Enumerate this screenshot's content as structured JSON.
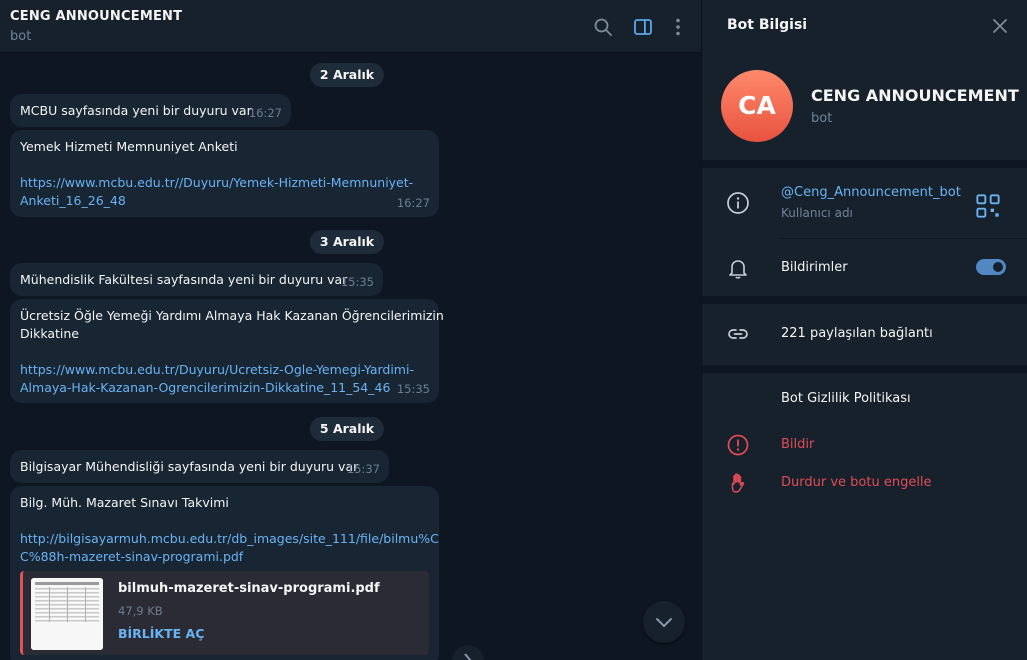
{
  "colors": {
    "accent": "#6ab3f3",
    "danger": "#e04b55",
    "bubble": "#182533",
    "panel": "#17212b",
    "background": "#0e1621",
    "avatar": "#ef6b50"
  },
  "header": {
    "title": "CENG ANNOUNCEMENT",
    "subtitle": "bot",
    "icons": [
      "search-icon",
      "sidebar-toggle-icon",
      "more-vertical-icon"
    ]
  },
  "messages": {
    "date1": "2 Aralık",
    "m1": {
      "text": "MCBU sayfasında yeni bir duyuru var",
      "time": "16:27"
    },
    "m2": {
      "title": "Yemek Hizmeti Memnuniyet Anketi",
      "link1": "https://www.mcbu.edu.tr//Duyuru/Yemek-Hizmeti-Memnuniyet-",
      "link2": "Anketi_16_26_48",
      "time": "16:27"
    },
    "date2": "3 Aralık",
    "m3": {
      "text": "Mühendislik Fakültesi sayfasında yeni bir duyuru var",
      "time": "15:35"
    },
    "m4": {
      "title1": "Ücretsiz Öğle Yemeği Yardımı Almaya Hak Kazanan Öğrencilerimizin",
      "title2": "Dikkatine",
      "link1": "https://www.mcbu.edu.tr/Duyuru/Ucretsiz-Ogle-Yemegi-Yardimi-",
      "link2": "Almaya-Hak-Kazanan-Ogrencilerimizin-Dikkatine_11_54_46",
      "time": "15:35"
    },
    "date3": "5 Aralık",
    "m5": {
      "text": "Bilgisayar Mühendisliği sayfasında yeni bir duyuru var",
      "time": "15:37"
    },
    "m6": {
      "title": "Bilg. Müh. Mazaret Sınavı Takvimi",
      "link1": "http://bilgisayarmuh.mcbu.edu.tr/db_images/site_111/file/bilmu%C",
      "link2": "C%88h-mazeret-sinav-programi.pdf",
      "file": {
        "name": "bilmuh-mazeret-sinav-programi.pdf",
        "size": "47,9 KB",
        "action": "BİRLİKTE AÇ"
      }
    }
  },
  "panel": {
    "title": "Bot Bilgisi",
    "avatar_initials": "CA",
    "name": "CENG ANNOUNCEMENT",
    "subtitle": "bot",
    "username": "@Ceng_Announcement_bot",
    "username_label": "Kullanıcı adı",
    "notifications_label": "Bildirimler",
    "notifications_on": true,
    "shared_links": "221 paylaşılan bağlantı",
    "privacy": "Bot Gizlilik Politikası",
    "report": "Bildir",
    "block": "Durdur ve botu engelle"
  }
}
